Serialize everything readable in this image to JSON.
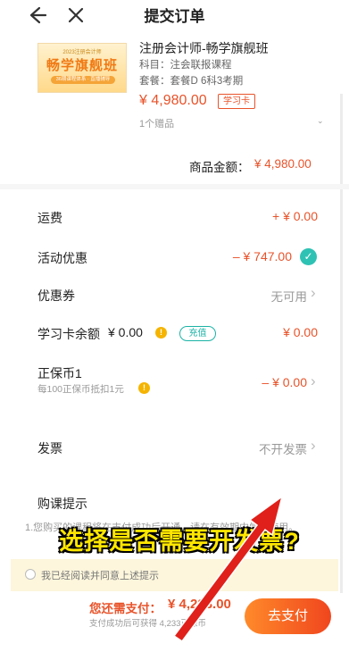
{
  "header": {
    "title": "提交订单",
    "back_icon": "back-arrow-icon",
    "close_icon": "close-icon"
  },
  "product": {
    "thumb_top": "2023注册会计师",
    "thumb_main": "畅学旗舰班",
    "thumb_bar": "36期课程体系 · 直播辅导",
    "title": "注册会计师-畅学旗舰班",
    "subject": "科目：注会联报课程",
    "package": "套餐：套餐D 6科3考期",
    "price": "¥ 4,980.00",
    "card_tag": "学习卡",
    "gift": "1个赠品"
  },
  "amount": {
    "label": "商品金额：",
    "value": "¥ 4,980.00"
  },
  "rows": {
    "shipping": {
      "label": "运费",
      "value": "+ ¥ 0.00"
    },
    "discount": {
      "label": "活动优惠",
      "value": "– ¥ 747.00"
    },
    "coupon": {
      "label": "优惠券",
      "value": "无可用"
    },
    "card_balance": {
      "label": "学习卡余额",
      "amount": "¥ 0.00",
      "recharge": "充值",
      "value": "¥ 0.00"
    },
    "coins": {
      "label": "正保币1",
      "note": "每100正保币抵扣1元",
      "value": "– ¥ 0.00"
    },
    "invoice": {
      "label": "发票",
      "value": "不开发票"
    }
  },
  "tips": {
    "title": "购课提示",
    "text": "1.您购买的课程将在支付成功后开通，请在有效期内学习使用。"
  },
  "agree": {
    "text": "我已经阅读并同意上述提示"
  },
  "footer": {
    "due_label": "您还需支付：",
    "due_value": "¥ 4,233.00",
    "due_note": "支付成功后可获得 4,233正保币",
    "pay_button": "去支付"
  },
  "overlay": {
    "caption": "选择是否需要开发票?"
  },
  "colors": {
    "accent": "#e8532a",
    "teal": "#2ec2b4",
    "caption": "#ffe600",
    "arrow": "#e0201a"
  }
}
